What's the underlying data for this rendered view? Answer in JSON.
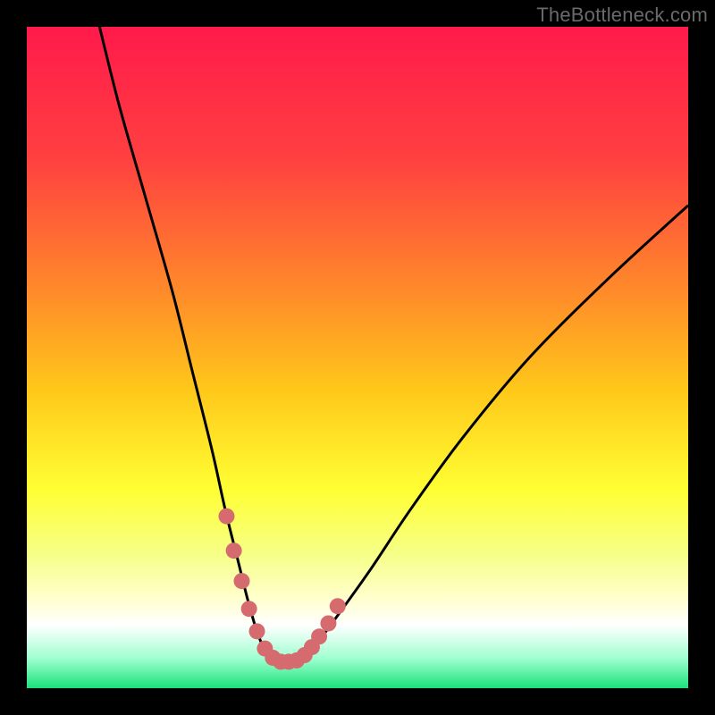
{
  "watermark": "TheBottleneck.com",
  "colors": {
    "page_bg": "#000000",
    "curve": "#000000",
    "marker_fill": "#d66b6f",
    "gradient_stops": [
      {
        "offset": 0.0,
        "color": "#ff1a4b"
      },
      {
        "offset": 0.2,
        "color": "#ff4040"
      },
      {
        "offset": 0.4,
        "color": "#ff8a2a"
      },
      {
        "offset": 0.55,
        "color": "#ffc81a"
      },
      {
        "offset": 0.7,
        "color": "#ffff33"
      },
      {
        "offset": 0.8,
        "color": "#f6ff8a"
      },
      {
        "offset": 0.86,
        "color": "#ffffc8"
      },
      {
        "offset": 0.905,
        "color": "#ffffff"
      },
      {
        "offset": 0.955,
        "color": "#9fffd0"
      },
      {
        "offset": 1.0,
        "color": "#1ae27a"
      }
    ]
  },
  "chart_data": {
    "type": "line",
    "title": "",
    "xlabel": "",
    "ylabel": "",
    "xlim": [
      0,
      100
    ],
    "ylim": [
      0,
      100
    ],
    "series": [
      {
        "name": "bottleneck-curve",
        "x": [
          11,
          14,
          18,
          22,
          25,
          28,
          30,
          32,
          33.5,
          35,
          36.5,
          38,
          40,
          42,
          44,
          47,
          52,
          58,
          66,
          76,
          88,
          100
        ],
        "y": [
          100,
          88,
          74,
          60,
          48,
          36,
          27,
          19,
          13,
          8,
          5,
          4,
          4,
          5,
          7,
          11,
          18,
          27,
          38,
          50,
          62,
          73
        ]
      }
    ],
    "highlight_points": {
      "name": "valley-markers",
      "x": [
        30.2,
        31.3,
        32.5,
        33.6,
        34.8,
        36.0,
        37.2,
        38.4,
        39.6,
        40.8,
        42.0,
        43.1,
        44.2,
        45.6,
        47.0
      ],
      "y": [
        26.0,
        20.8,
        16.2,
        12.0,
        8.6,
        6.0,
        4.6,
        4.0,
        4.0,
        4.2,
        5.0,
        6.2,
        7.8,
        9.8,
        12.4
      ]
    }
  }
}
